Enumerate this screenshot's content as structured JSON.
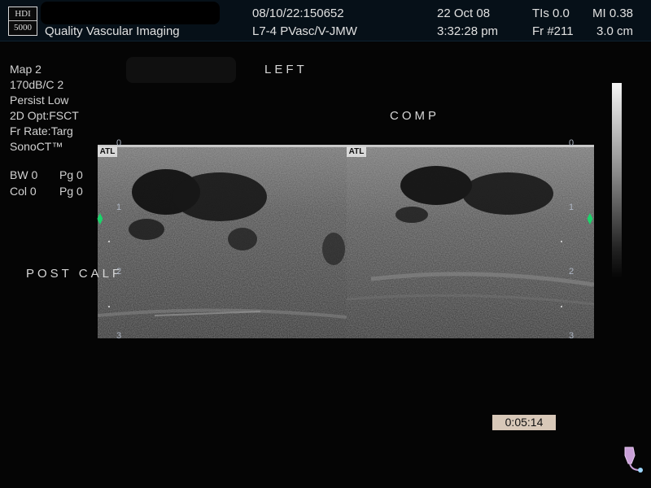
{
  "header": {
    "logo_top": "HDI",
    "logo_bottom": "5000",
    "facility": "Quality Vascular Imaging",
    "study_id": "08/10/22:150652",
    "probe_preset": "L7-4 PVasc/V-JMW",
    "date": "22 Oct 08",
    "time": "3:32:28 pm",
    "tis": "TIs 0.0",
    "mi": "MI 0.38",
    "frame": "Fr #211",
    "depth_cm": "3.0 cm"
  },
  "settings": {
    "lines": [
      "Map 2",
      "170dB/C 2",
      "Persist Low",
      "2D Opt:FSCT",
      "Fr Rate:Targ",
      "SonoCT™"
    ],
    "bw": "BW 0",
    "pg1": "Pg 0",
    "col": "Col 0",
    "pg2": "Pg 0"
  },
  "annotations": {
    "left": "LEFT",
    "comp": "COMP",
    "post_calf": "POST CALF"
  },
  "image_tags": {
    "left_tag": "ATL",
    "right_tag": "ATL"
  },
  "depth_scale": {
    "left": [
      "0",
      "1",
      "2",
      "3"
    ],
    "right": [
      "0",
      "1",
      "2",
      "3"
    ]
  },
  "timer": "0:05:14",
  "colors": {
    "background": "#050505",
    "text": "#e8e8e8",
    "arrows": "#19d66a",
    "timer_bg": "#d8c8b8"
  },
  "icons": {
    "probe": "probe-icon",
    "depth_arrows": "up-down-arrow-icon"
  }
}
